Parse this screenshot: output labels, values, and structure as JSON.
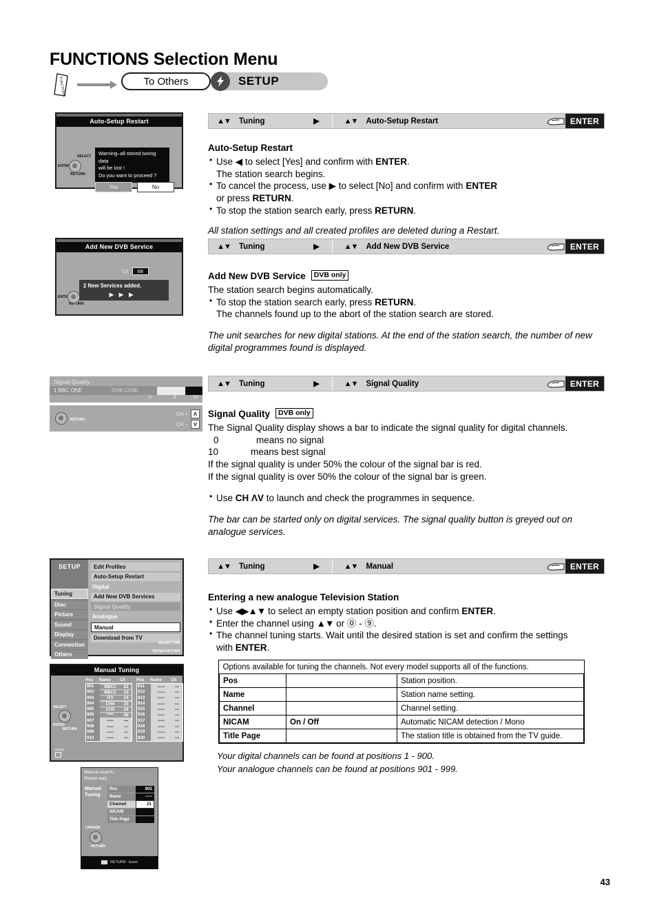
{
  "page": {
    "number": "43"
  },
  "header": {
    "title_bold": "FUNCTIONS",
    "title_rest": " Selection Menu",
    "functions_button_label": "FUNCTIONS",
    "to_others": "To Others",
    "setup": "SETUP",
    "setup_badge_icon": "lightning-icon"
  },
  "navbars": {
    "autosetup": {
      "col1": "Tuning",
      "col2": "Auto-Setup Restart",
      "enter": "ENTER",
      "updown_icon": "up-down-arrows-icon",
      "right_icon": "right-triangle-icon",
      "hand_icon": "hand-press-icon"
    },
    "adddvb": {
      "col1": "Tuning",
      "col2": "Add New DVB Service",
      "enter": "ENTER"
    },
    "signal": {
      "col1": "Tuning",
      "col2": "Signal Quality",
      "enter": "ENTER"
    },
    "manual": {
      "col1": "Tuning",
      "col2": "Manual",
      "enter": "ENTER"
    }
  },
  "sections": {
    "autosetup": {
      "heading": "Auto-Setup Restart",
      "b1_a": "Use ",
      "b1_b": " to select [Yes] and confirm with ",
      "b1_c": "ENTER",
      "b1_d": ".",
      "b1_line2": "The station search begins.",
      "b2_a": "To cancel the process, use ",
      "b2_b": " to select [No] and confirm with ",
      "b2_c": "ENTER",
      "b2_line2_a": "or press ",
      "b2_line2_b": "RETURN",
      "b2_line2_c": ".",
      "b3_a": "To stop the station search early, press ",
      "b3_b": "RETURN",
      "b3_c": ".",
      "note": "All station settings and all created profiles are deleted during a Restart."
    },
    "adddvb": {
      "heading": "Add New DVB Service",
      "badge": "DVB only",
      "line1": "The station search begins automatically.",
      "b1_a": "To stop the station search early, press ",
      "b1_b": "RETURN",
      "b1_c": ".",
      "b1_line2": "The channels found up to the abort of the station search are stored.",
      "note": "The unit searches for new digital stations. At the end of the station search, the number of new digital programmes found is displayed."
    },
    "signal": {
      "heading": "Signal Quality",
      "badge": "DVB only",
      "line1": "The Signal Quality display shows a bar to indicate the signal quality for digital channels.",
      "scale_0": "0",
      "scale_0_txt": "means no signal",
      "scale_10": "10",
      "scale_10_txt": "means best signal",
      "line2": "If the signal quality is under 50% the colour of the signal bar is red.",
      "line3": "If the signal quality is over 50% the colour of the signal bar is green.",
      "b1_a": "Use ",
      "b1_b": "CH ΛV",
      "b1_c": " to launch and check the programmes in sequence.",
      "note": "The bar can be started only on digital services. The signal quality button is greyed out on analogue services."
    },
    "manual": {
      "heading": "Entering a new analogue Television Station",
      "b1_a": "Use ",
      "b1_b": " to select an empty station position and confirm ",
      "b1_c": "ENTER",
      "b1_d": ".",
      "b2_a": "Enter the channel using ",
      "b2_b": " or ",
      "b2_c": " - ",
      "b2_d": ".",
      "b3_a": "The channel tuning starts. Wait until the desired station is set and confirm the settings",
      "b3_line2_a": "with ",
      "b3_line2_b": "ENTER",
      "b3_line2_c": "."
    }
  },
  "options_table": {
    "caption": "Options available for tuning the channels. Not every model supports all of the functions.",
    "rows": [
      {
        "key": "Pos",
        "mid": "",
        "desc": "Station position."
      },
      {
        "key": "Name",
        "mid": "",
        "desc": "Station name setting."
      },
      {
        "key": "Channel",
        "mid": "",
        "desc": "Channel setting."
      },
      {
        "key": "NICAM",
        "mid": "On / Off",
        "desc": "Automatic NICAM detection / Mono"
      },
      {
        "key": "Title Page",
        "mid": "",
        "desc": "The station title is obtained from the TV guide."
      }
    ]
  },
  "footnote": {
    "line1": "Your digital channels can be found at positions 1 - 900.",
    "line2": "Your analogue channels can be found at positions 901 - 999."
  },
  "screens": {
    "autosetup_dialog": {
      "title": "Auto-Setup Restart",
      "warn_l1": "Warning–all stored tuning data",
      "warn_l2": "will be lost !",
      "warn_l3": "Do you want to proceed ?",
      "yes": "Yes",
      "no": "No",
      "select_label": "SELECT",
      "enter_label": "ENTER",
      "return_label": "RETURN"
    },
    "adddvb_dialog": {
      "title": "Add New DVB Service",
      "ch_label": "Ch",
      "ch_value": "68",
      "message": "2 New Services added.",
      "progress_icon": "triangles-icon",
      "enter_label": "ENTER",
      "return_label": "RETURN"
    },
    "signal_quality": {
      "title": "Signal Quality",
      "station": "1 BBC ONE",
      "source": "DVB CH30",
      "bar_percent": 62,
      "scale": [
        "0",
        "5",
        "10"
      ],
      "ch_up": "CH +",
      "ch_down": "CH –",
      "key_up": "Λ",
      "key_down": "V",
      "return_label": "RETURN"
    },
    "setup_menu": {
      "title": "SETUP",
      "left_items": [
        "Tuning",
        "Disc",
        "Picture",
        "Sound",
        "Display",
        "Connection",
        "Others"
      ],
      "selected_left": "Tuning",
      "right_items": [
        {
          "label": "Edit Profiles",
          "style": "normal"
        },
        {
          "label": "Auto-Setup Restart",
          "style": "normal"
        },
        {
          "label": "Digital",
          "style": "header"
        },
        {
          "label": "Add New DVB Services",
          "style": "normal"
        },
        {
          "label": "Signal Quality",
          "style": "grey"
        },
        {
          "label": "Analogue",
          "style": "header"
        },
        {
          "label": "Manual",
          "style": "white"
        },
        {
          "label": "Download from TV",
          "style": "normal"
        }
      ],
      "pad_select": "SELECT",
      "pad_tab": "TAB",
      "pad_enter": "ENTER",
      "pad_return": "RETURN"
    },
    "manual_tuning": {
      "title": "Manual Tuning",
      "headers": [
        "Pos",
        "Name",
        "Ch"
      ],
      "left_rows": [
        {
          "pos": "901",
          "name": "BBC1",
          "ch": "22",
          "filled": true
        },
        {
          "pos": "902",
          "name": "BBC2",
          "ch": "23",
          "filled": true
        },
        {
          "pos": "903",
          "name": "ITV",
          "ch": "24",
          "filled": true
        },
        {
          "pos": "904",
          "name": "CH4",
          "ch": "25",
          "filled": true
        },
        {
          "pos": "905",
          "name": "CH5",
          "ch": "26",
          "filled": true
        },
        {
          "pos": "906",
          "name": "****",
          "ch": "36",
          "filled": true
        },
        {
          "pos": "907",
          "name": "-----",
          "ch": "—",
          "filled": false
        },
        {
          "pos": "908",
          "name": "-----",
          "ch": "---",
          "filled": false
        },
        {
          "pos": "909",
          "name": "-----",
          "ch": "---",
          "filled": false
        },
        {
          "pos": "910",
          "name": "-----",
          "ch": "---",
          "filled": false
        }
      ],
      "right_rows": [
        {
          "pos": "911",
          "name": "-----",
          "ch": "---",
          "filled": false
        },
        {
          "pos": "912",
          "name": "-----",
          "ch": "---",
          "filled": false
        },
        {
          "pos": "913",
          "name": "-----",
          "ch": "---",
          "filled": false
        },
        {
          "pos": "914",
          "name": "-----",
          "ch": "---",
          "filled": false
        },
        {
          "pos": "915",
          "name": "-----",
          "ch": "---",
          "filled": false
        },
        {
          "pos": "916",
          "name": "-----",
          "ch": "---",
          "filled": false
        },
        {
          "pos": "917",
          "name": "-----",
          "ch": "---",
          "filled": false
        },
        {
          "pos": "918",
          "name": "-----",
          "ch": "---",
          "filled": false
        },
        {
          "pos": "919",
          "name": "-----",
          "ch": "---",
          "filled": false
        },
        {
          "pos": "920",
          "name": "-----",
          "ch": "---",
          "filled": false
        }
      ],
      "pad_select": "SELECT",
      "pad_enter": "ENTER",
      "pad_return": "RETURN",
      "delete_label": "Delete"
    },
    "manual_search": {
      "head_l1": "Manual search...",
      "head_l2": "Please wait.",
      "side_l1": "Manual",
      "side_l2": "Tuning",
      "rows": [
        {
          "key": "Pos",
          "value": "902",
          "selected": false
        },
        {
          "key": "Name",
          "value": "-----",
          "selected": false
        },
        {
          "key": "Channel",
          "value": "21",
          "selected": true
        },
        {
          "key": "NICAM",
          "value": "",
          "selected": false
        },
        {
          "key": "Title Page",
          "value": "",
          "selected": false
        }
      ],
      "pad_change": "CHANGE",
      "pad_return": "RETURN",
      "foot": "RETURN : leave"
    }
  }
}
